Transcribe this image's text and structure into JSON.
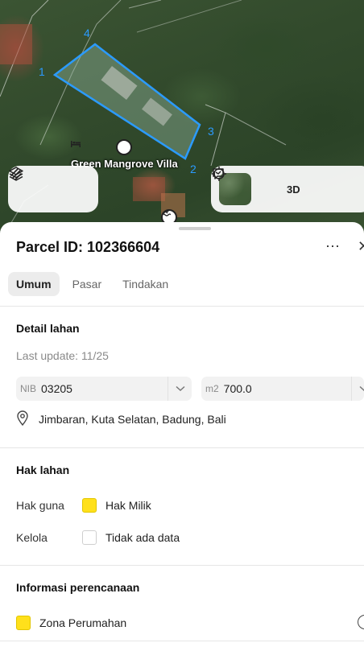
{
  "map": {
    "poi_name": "Green Mangrove Villa",
    "poi_icon": "bed-icon",
    "second_poi_icon": "swimmer-icon",
    "parcel_corner_labels": [
      "1",
      "2",
      "3",
      "4"
    ],
    "parcel_outline_color": "#2b9bff",
    "controls_left": [
      "layers-icon",
      "draw-icon"
    ],
    "controls_right": {
      "thumbnail": "satellite-thumbnail",
      "locate_icon": "crosshair-icon",
      "threed_label": "3D",
      "feedback_icon": "feedback-icon"
    }
  },
  "sheet": {
    "title": "Parcel ID: 102366604",
    "more_icon": "⋯",
    "close_icon": "✕",
    "tabs": [
      {
        "label": "Umum",
        "active": true
      },
      {
        "label": "Pasar",
        "active": false
      },
      {
        "label": "Tindakan",
        "active": false
      }
    ],
    "detail": {
      "title": "Detail lahan",
      "last_update": "Last update: 11/25",
      "nib_prefix": "NIB",
      "nib_value": "03205",
      "area_prefix": "m2",
      "area_value": "700.0",
      "address": "Jimbaran, Kuta Selatan, Badung, Bali"
    },
    "rights": {
      "title": "Hak lahan",
      "rows": [
        {
          "key": "Hak guna",
          "value": "Hak Milik",
          "color": "#ffe01b"
        },
        {
          "key": "Kelola",
          "value": "Tidak ada data",
          "color": "#ffffff"
        }
      ]
    },
    "planning": {
      "title": "Informasi perencanaan",
      "zone": "Zona Perumahan",
      "zone_color": "#ffe01b"
    }
  }
}
